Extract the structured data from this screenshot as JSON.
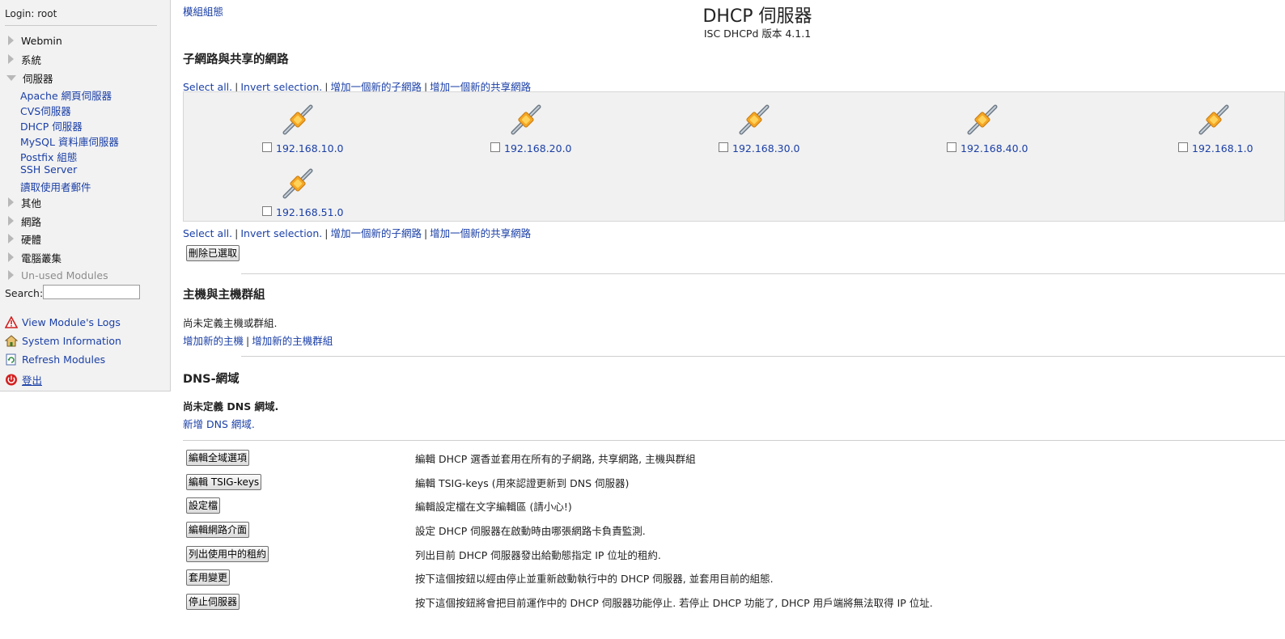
{
  "sidebar": {
    "login": "Login: root",
    "categories": {
      "webmin": "Webmin",
      "system": "系統",
      "servers": "伺服器",
      "others": "其他",
      "network": "網路",
      "hardware": "硬體",
      "cluster": "電腦叢集",
      "unused": "Un-used Modules"
    },
    "server_modules": [
      "Apache 網頁伺服器",
      "CVS伺服器",
      "DHCP 伺服器",
      "MySQL 資料庫伺服器",
      "Postfix 組態",
      "SSH Server",
      "讀取使用者郵件"
    ],
    "search_label": "Search:",
    "search_value": "",
    "actions": {
      "logs": "View Module's Logs",
      "sysinfo": "System Information",
      "refresh": "Refresh Modules",
      "logout": "登出"
    },
    "icons": [
      "warning-icon",
      "house-icon",
      "refresh-icon",
      "power-icon"
    ]
  },
  "header": {
    "module_config": "模組組態",
    "title": "DHCP 伺服器",
    "subtitle": "ISC DHCPd 版本 4.1.1"
  },
  "subnets": {
    "title": "子網路與共享的網路",
    "select_all": "Select all.",
    "invert": "Invert selection.",
    "add_subnet": "增加一個新的子網路",
    "add_shared": "增加一個新的共享網路",
    "networks": [
      "192.168.10.0",
      "192.168.20.0",
      "192.168.30.0",
      "192.168.40.0",
      "192.168.1.0",
      "192.168.51.0"
    ],
    "network_icon": "network-cable-icon",
    "delete_button": "刪除已選取"
  },
  "hosts": {
    "title": "主機與主機群組",
    "empty": "尚未定義主機或群組.",
    "add_host": "增加新的主機",
    "add_group": "增加新的主機群組"
  },
  "dns": {
    "title": "DNS-網域",
    "empty": "尚未定義 DNS 網域.",
    "add_zone": "新增 DNS 網域."
  },
  "actions": [
    {
      "button": "編輯全域選項",
      "desc": "編輯 DHCP 選香並套用在所有的子網路, 共享網路, 主機與群組"
    },
    {
      "button": "編輯 TSIG-keys",
      "desc": "編輯 TSIG-keys (用來認證更新到 DNS 伺服器)"
    },
    {
      "button": "設定檔",
      "desc": "編輯設定檔在文字編輯區 (請小心!)"
    },
    {
      "button": "編輯網路介面",
      "desc": "設定 DHCP 伺服器在啟動時由哪張網路卡負責監測."
    },
    {
      "button": "列出使用中的租約",
      "desc": "列出目前 DHCP 伺服器發出給動態指定 IP 位址的租約."
    },
    {
      "button": "套用變更",
      "desc": "按下這個按鈕以經由停止並重新啟動執行中的 DHCP 伺服器, 並套用目前的組態."
    },
    {
      "button": "停止伺服器",
      "desc": "按下這個按鈕將會把目前運作中的 DHCP 伺服器功能停止. 若停止 DHCP 功能了, DHCP 用戶端將無法取得 IP 位址."
    }
  ]
}
